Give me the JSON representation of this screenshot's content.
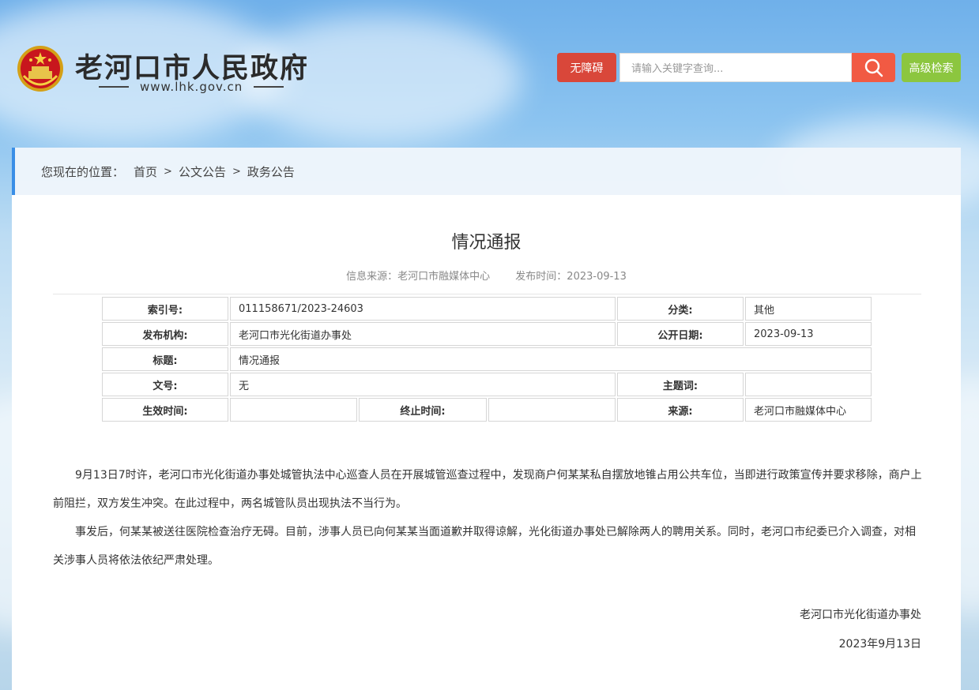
{
  "header": {
    "site_title": "老河口市人民政府",
    "site_url": "www.lhk.gov.cn",
    "accessible_label": "无障碍",
    "search_placeholder": "请输入关键字查询...",
    "advanced_search_label": "高级检索",
    "emblem_icon": "national-emblem-icon",
    "search_icon": "search-icon"
  },
  "breadcrumb": {
    "label": "您现在的位置：",
    "items": [
      "首页",
      "公文公告",
      "政务公告"
    ],
    "separator": ">"
  },
  "article": {
    "title": "情况通报",
    "source": "信息来源：老河口市融媒体中心",
    "publish_time": "发布时间：2023-09-13",
    "info": {
      "index_label": "索引号:",
      "index_value": "011158671/2023-24603",
      "category_label": "分类:",
      "category_value": "其他",
      "publisher_label": "发布机构:",
      "publisher_value": "老河口市光化街道办事处",
      "open_date_label": "公开日期:",
      "open_date_value": "2023-09-13",
      "title_label": "标题:",
      "title_value": "情况通报",
      "doc_no_label": "文号:",
      "doc_no_value": "无",
      "keywords_label": "主题词:",
      "keywords_value": "",
      "effective_label": "生效时间:",
      "effective_value": "",
      "expire_label": "终止时间:",
      "expire_value": "",
      "origin_label": "来源:",
      "origin_value": "老河口市融媒体中心"
    },
    "paragraphs": [
      "9月13日7时许，老河口市光化街道办事处城管执法中心巡查人员在开展城管巡查过程中，发现商户何某某私自摆放地锥占用公共车位，当即进行政策宣传并要求移除，商户上前阻拦，双方发生冲突。在此过程中，两名城管队员出现执法不当行为。",
      "事发后，何某某被送往医院检查治疗无碍。目前，涉事人员已向何某某当面道歉并取得谅解，光化街道办事处已解除两人的聘用关系。同时，老河口市纪委已介入调查，对相关涉事人员将依法依纪严肃处理。"
    ],
    "signature_org": "老河口市光化街道办事处",
    "signature_date": "2023年9月13日"
  },
  "colors": {
    "accessible_btn": "#d9473a",
    "search_btn": "#f15a43",
    "advanced_btn": "#8cc63f",
    "breadcrumb_accent": "#3a8ee6"
  }
}
